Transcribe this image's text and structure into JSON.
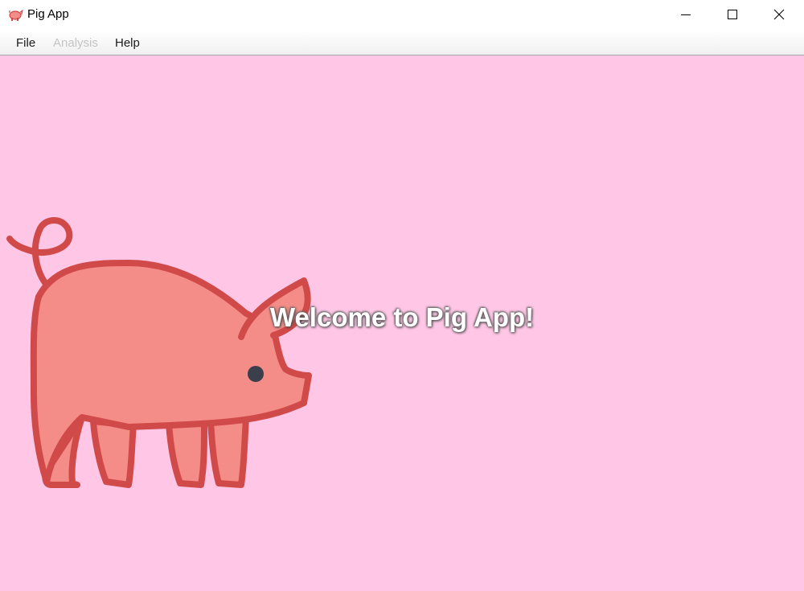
{
  "window": {
    "title": "Pig App",
    "icon": "pig-icon",
    "controls": [
      "minimize-icon",
      "maximize-icon",
      "close-icon"
    ]
  },
  "menu": {
    "file": "File",
    "analysis": "Analysis",
    "help": "Help"
  },
  "main": {
    "welcome": "Welcome to Pig App!",
    "image": "pig-illustration"
  },
  "colors": {
    "background": "#ffc6e5",
    "pig_body": "#f48c87",
    "pig_outline": "#d14a4a",
    "menu_disabled": "#c4c4c4"
  }
}
